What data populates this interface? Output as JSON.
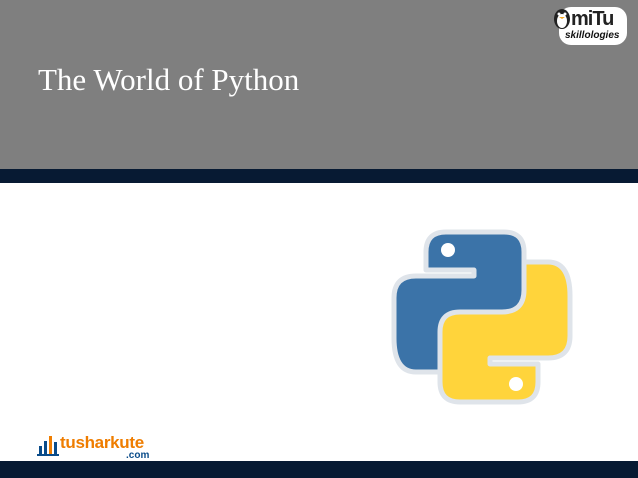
{
  "slide": {
    "title": "The World of Python"
  },
  "logos": {
    "top_right_brand": "miTu",
    "top_right_tagline": "skillologies",
    "bottom_left_brand": "tusharkute",
    "bottom_left_domain": ".com"
  },
  "colors": {
    "header": "#7f7f7f",
    "band": "#071a33",
    "python_blue": "#3b73a8",
    "python_yellow": "#ffd43b"
  }
}
